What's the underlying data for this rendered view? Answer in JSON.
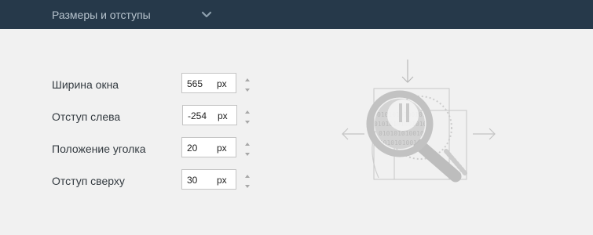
{
  "header": {
    "title": "Размеры и отступы",
    "chevron_icon": "chevron-down-icon"
  },
  "fields": [
    {
      "label": "Ширина окна",
      "value": "565",
      "unit": "px"
    },
    {
      "label": "Отступ слева",
      "value": "-254",
      "unit": "px"
    },
    {
      "label": "Положение уголка",
      "value": "20",
      "unit": "px"
    },
    {
      "label": "Отступ сверху",
      "value": "30",
      "unit": "px"
    }
  ],
  "illustration": {
    "icon": "magnifier-layout-diagram-icon",
    "binary_text": "0101010100101010110010100101"
  },
  "colors": {
    "header_bg": "#26394a",
    "header_text": "#b7c3cd",
    "panel_bg": "#f1f1f1",
    "field_border": "#c4c4c4",
    "label_text": "#333a40"
  }
}
